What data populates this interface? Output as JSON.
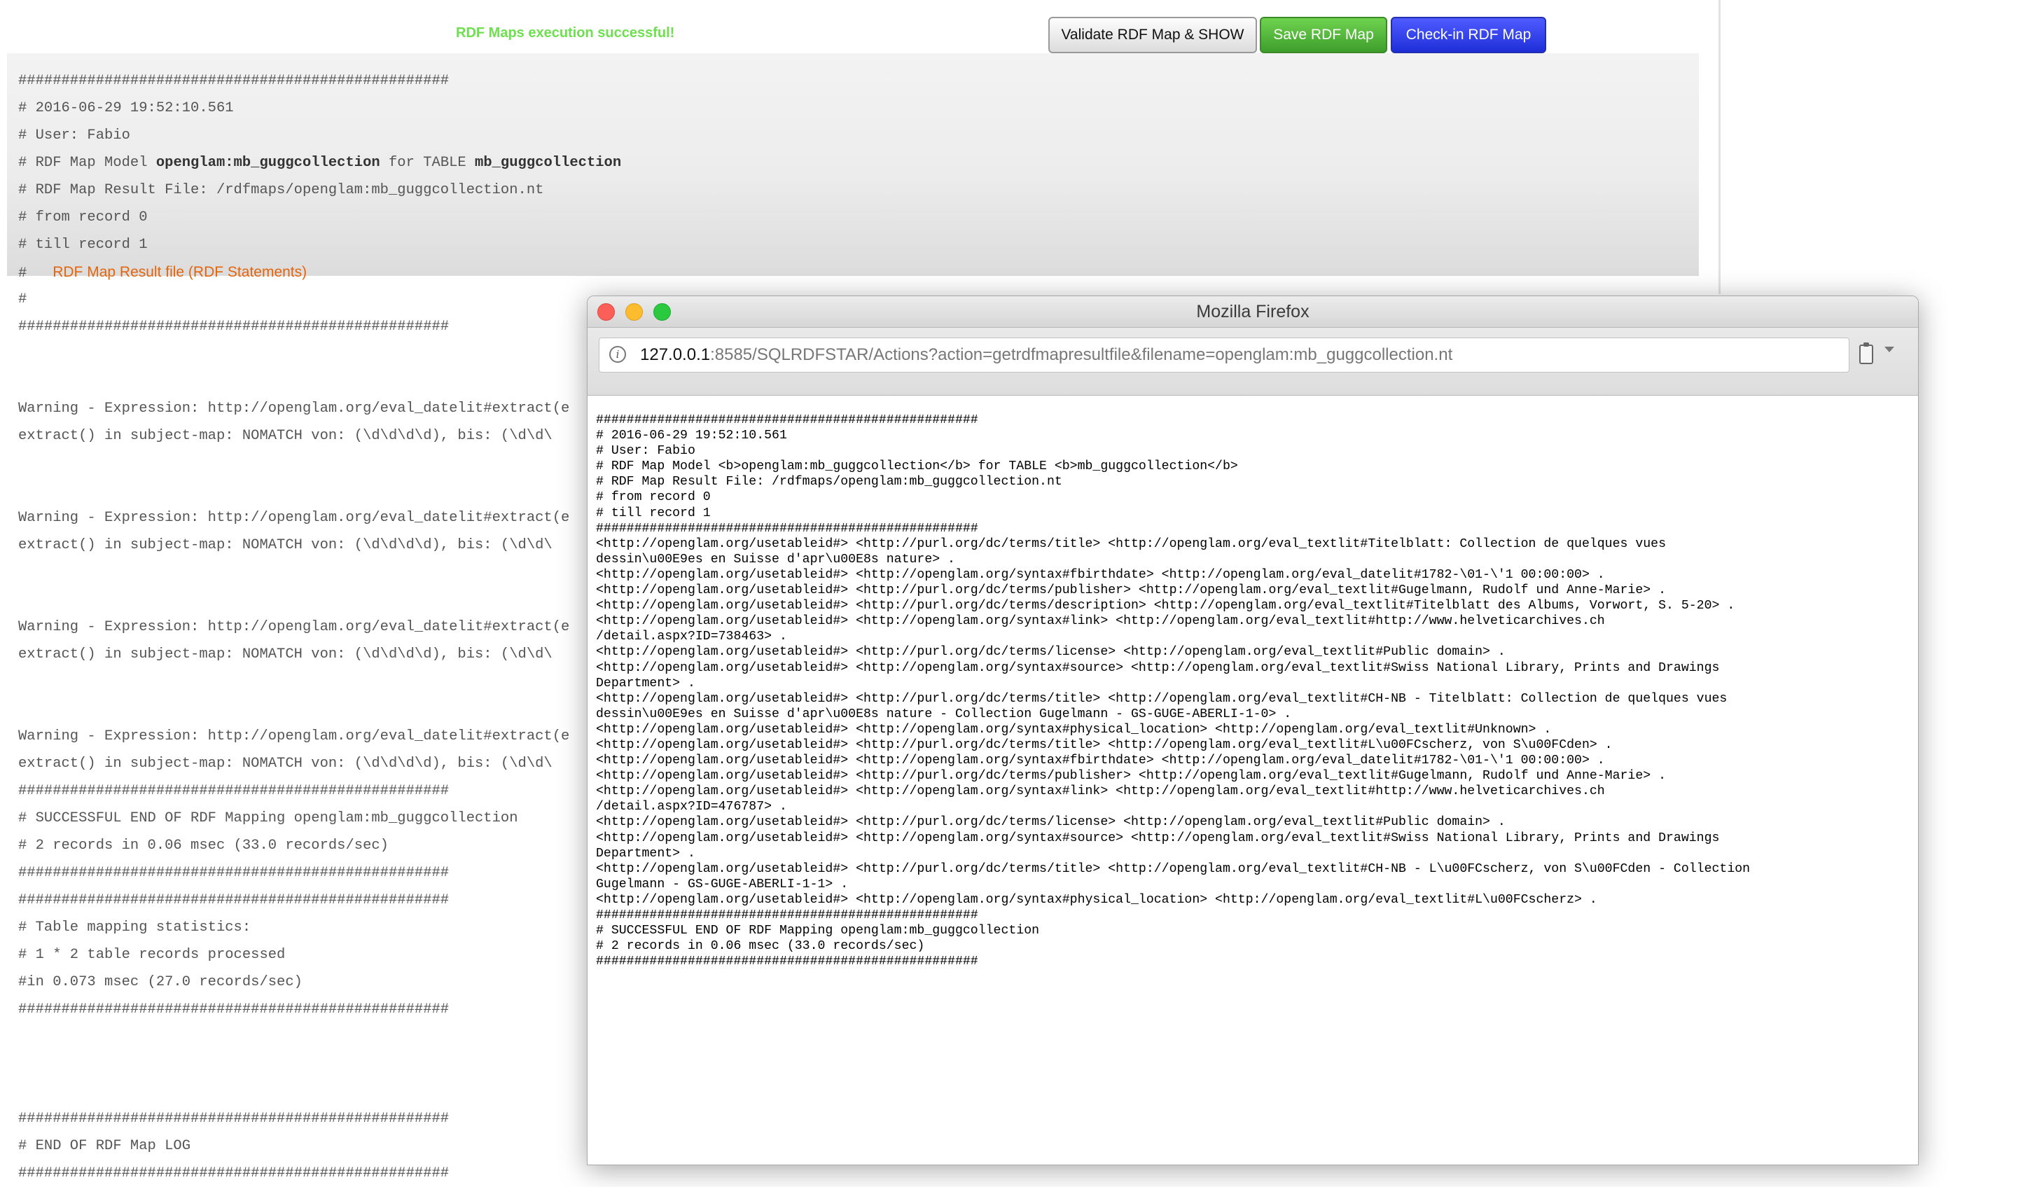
{
  "top_bar": {
    "success_message": "RDF Maps execution successful!",
    "validate_button": "Validate RDF Map & SHOW",
    "save_button": "Save RDF Map",
    "checkin_button": "Check-in RDF Map"
  },
  "log": [
    "##################################################",
    "# 2016-06-29 19:52:10.561",
    "# User: Fabio",
    "# RDF Map Model <b>opengl am:mb_guggcollection</b> for TABLE <b>mb_guggcollection</b>",
    "# RDF Map Result File: /rdfmaps/openglam:mb_guggcollection.nt",
    "# from record 0",
    "# till record 1",
    "#   [RDF Map Result file (RDF Statements)]",
    "#",
    "##################################################",
    "",
    "",
    "Warning - Expression: http://openglam.org/eval_datelit#extract(e",
    "extract() in subject-map: NOMATCH von: (\\d\\d\\d\\d), bis: (\\d\\d\\",
    "",
    "",
    "Warning - Expression: http://openglam.org/eval_datelit#extract(e",
    "extract() in subject-map: NOMATCH von: (\\d\\d\\d\\d), bis: (\\d\\d\\",
    "",
    "",
    "Warning - Expression: http://openglam.org/eval_datelit#extract(e",
    "extract() in subject-map: NOMATCH von: (\\d\\d\\d\\d), bis: (\\d\\d\\",
    "",
    "",
    "Warning - Expression: http://openglam.org/eval_datelit#extract(e",
    "extract() in subject-map: NOMATCH von: (\\d\\d\\d\\d), bis: (\\d\\d\\",
    "##################################################",
    "# SUCCESSFUL END OF RDF Mapping openglam:mb_guggcollection",
    "# 2 records in 0.06 msec (33.0 records/sec)",
    "##################################################",
    "##################################################",
    "# Table mapping statistics:",
    "# 1 * 2 table records processed",
    "#in 0.073 msec (27.0 records/sec)",
    "##################################################",
    "",
    "",
    "",
    "##################################################",
    "# END OF RDF Map LOG",
    "##################################################"
  ],
  "log_orange_link": "RDF Map Result file (RDF Statements)",
  "log_model_name": "openglam:mb_guggcollection",
  "log_table_name": "mb_guggcollection",
  "firefox": {
    "window_title": "Mozilla Firefox",
    "url_host": "127.0.0.1",
    "url_rest": ":8585/SQLRDFSTAR/Actions?action=getrdfmapresultfile&filename=openglam:mb_guggcollection.nt",
    "content_lines": [
      "##################################################",
      "# 2016-06-29 19:52:10.561",
      "# User: Fabio",
      "# RDF Map Model <b>openglam:mb_guggcollection</b> for TABLE <b>mb_guggcollection</b>",
      "# RDF Map Result File: /rdfmaps/openglam:mb_guggcollection.nt",
      "# from record 0",
      "# till record 1",
      "##################################################",
      "<http://openglam.org/usetableid#> <http://purl.org/dc/terms/title> <http://openglam.org/eval_textlit#Titelblatt: Collection de quelques vues",
      "dessin\\u00E9es en Suisse d'apr\\u00E8s nature> .",
      "<http://openglam.org/usetableid#> <http://openglam.org/syntax#fbirthdate> <http://openglam.org/eval_datelit#1782-\\01-\\'1 00:00:00> .",
      "<http://openglam.org/usetableid#> <http://purl.org/dc/terms/publisher> <http://openglam.org/eval_textlit#Gugelmann, Rudolf und Anne-Marie> .",
      "<http://openglam.org/usetableid#> <http://purl.org/dc/terms/description> <http://openglam.org/eval_textlit#Titelblatt des Albums, Vorwort, S. 5-20> .",
      "<http://openglam.org/usetableid#> <http://openglam.org/syntax#link> <http://openglam.org/eval_textlit#http://www.helveticarchives.ch",
      "/detail.aspx?ID=738463> .",
      "<http://openglam.org/usetableid#> <http://purl.org/dc/terms/license> <http://openglam.org/eval_textlit#Public domain> .",
      "<http://openglam.org/usetableid#> <http://openglam.org/syntax#source> <http://openglam.org/eval_textlit#Swiss National Library, Prints and Drawings",
      "Department> .",
      "<http://openglam.org/usetableid#> <http://purl.org/dc/terms/title> <http://openglam.org/eval_textlit#CH-NB - Titelblatt: Collection de quelques vues",
      "dessin\\u00E9es en Suisse d'apr\\u00E8s nature - Collection Gugelmann - GS-GUGE-ABERLI-1-0> .",
      "<http://openglam.org/usetableid#> <http://openglam.org/syntax#physical_location> <http://openglam.org/eval_textlit#Unknown> .",
      "<http://openglam.org/usetableid#> <http://purl.org/dc/terms/title> <http://openglam.org/eval_textlit#L\\u00FCscherz, von S\\u00FCden> .",
      "<http://openglam.org/usetableid#> <http://openglam.org/syntax#fbirthdate> <http://openglam.org/eval_datelit#1782-\\01-\\'1 00:00:00> .",
      "<http://openglam.org/usetableid#> <http://purl.org/dc/terms/publisher> <http://openglam.org/eval_textlit#Gugelmann, Rudolf und Anne-Marie> .",
      "<http://openglam.org/usetableid#> <http://openglam.org/syntax#link> <http://openglam.org/eval_textlit#http://www.helveticarchives.ch",
      "/detail.aspx?ID=476787> .",
      "<http://openglam.org/usetableid#> <http://purl.org/dc/terms/license> <http://openglam.org/eval_textlit#Public domain> .",
      "<http://openglam.org/usetableid#> <http://openglam.org/syntax#source> <http://openglam.org/eval_textlit#Swiss National Library, Prints and Drawings",
      "Department> .",
      "<http://openglam.org/usetableid#> <http://purl.org/dc/terms/title> <http://openglam.org/eval_textlit#CH-NB - L\\u00FCscherz, von S\\u00FCden - Collection",
      "Gugelmann - GS-GUGE-ABERLI-1-1> .",
      "<http://openglam.org/usetableid#> <http://openglam.org/syntax#physical_location> <http://openglam.org/eval_textlit#L\\u00FCscherz> .",
      "##################################################",
      "# SUCCESSFUL END OF RDF Mapping openglam:mb_guggcollection",
      "# 2 records in 0.06 msec (33.0 records/sec)",
      "##################################################"
    ]
  },
  "colors": {
    "success_green": "#6ee04f",
    "save_green": "#4fb83a",
    "checkin_blue": "#2a3af0",
    "log_link_orange": "#e2660f"
  },
  "icons": [
    "info-icon",
    "clipboard-icon",
    "chevron-down-icon"
  ]
}
